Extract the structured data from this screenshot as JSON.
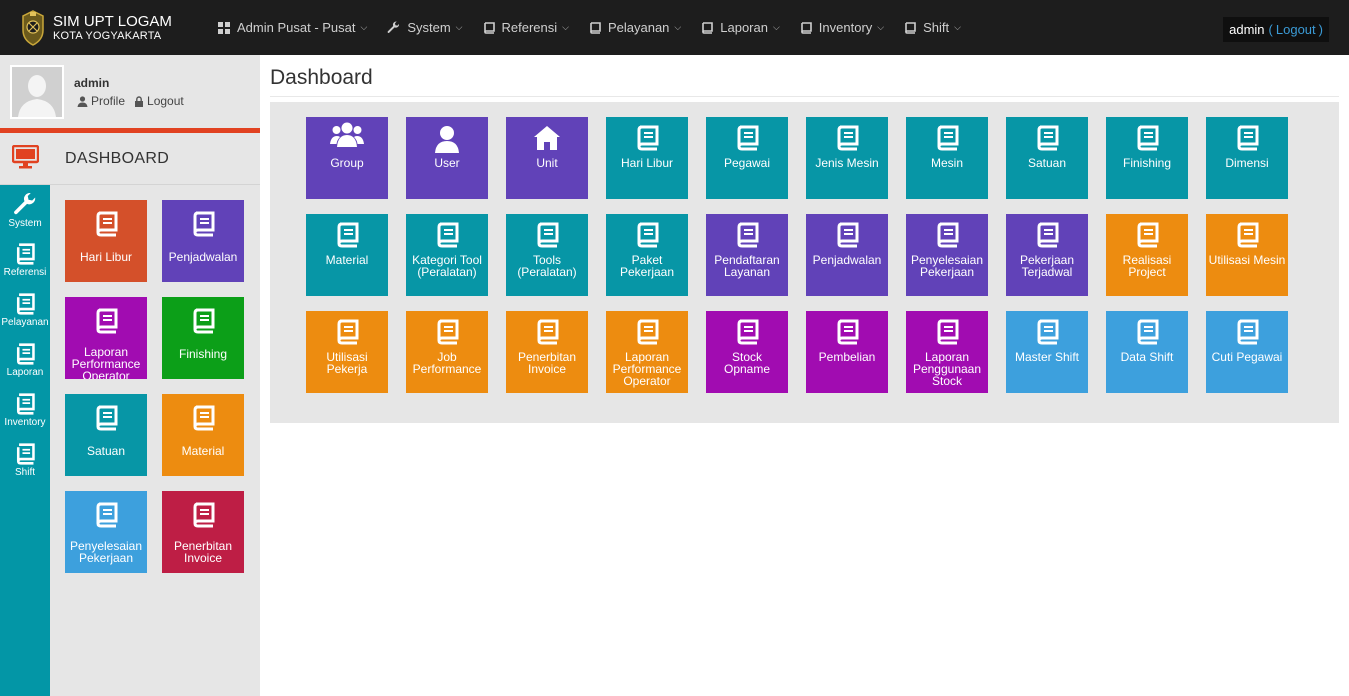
{
  "brand": {
    "title": "SIM UPT LOGAM",
    "subtitle": "KOTA YOGYAKARTA"
  },
  "nav": [
    {
      "label": "Admin Pusat - Pusat",
      "icon": "grid-icon"
    },
    {
      "label": "System",
      "icon": "wrench-icon"
    },
    {
      "label": "Referensi",
      "icon": "book-icon"
    },
    {
      "label": "Pelayanan",
      "icon": "book-icon"
    },
    {
      "label": "Laporan",
      "icon": "book-icon"
    },
    {
      "label": "Inventory",
      "icon": "book-icon"
    },
    {
      "label": "Shift",
      "icon": "book-icon"
    }
  ],
  "user_menu": {
    "name": "admin",
    "open": "(",
    "logout": "Logout",
    "close": ")"
  },
  "sidebar_user": {
    "name": "admin",
    "profile": "Profile",
    "logout": "Logout"
  },
  "sidebar_heading": "DASHBOARD",
  "icon_strip": [
    {
      "label": "System",
      "icon": "wrench-icon"
    },
    {
      "label": "Referensi",
      "icon": "book-icon"
    },
    {
      "label": "Pelayanan",
      "icon": "book-icon"
    },
    {
      "label": "Laporan",
      "icon": "book-icon"
    },
    {
      "label": "Inventory",
      "icon": "book-icon"
    },
    {
      "label": "Shift",
      "icon": "book-icon"
    }
  ],
  "side_tiles": [
    {
      "label": "Hari Libur",
      "color": "#d4502a"
    },
    {
      "label": "Penjadwalan",
      "color": "#6142b8"
    },
    {
      "label": "Laporan Performance Operator",
      "color": "#a10cb1"
    },
    {
      "label": "Finishing",
      "color": "#0c9f18"
    },
    {
      "label": "Satuan",
      "color": "#0796a6"
    },
    {
      "label": "Material",
      "color": "#ed8c10"
    },
    {
      "label": "Penyelesaian Pekerjaan",
      "color": "#3da0dd"
    },
    {
      "label": "Penerbitan Invoice",
      "color": "#be1e45"
    }
  ],
  "page_title": "Dashboard",
  "tiles": [
    {
      "label": "Group",
      "icon": "users-icon",
      "color": "#6142b8"
    },
    {
      "label": "User",
      "icon": "user-icon",
      "color": "#6142b8"
    },
    {
      "label": "Unit",
      "icon": "home-icon",
      "color": "#6142b8"
    },
    {
      "label": "Hari Libur",
      "icon": "book-icon",
      "color": "#0796a6"
    },
    {
      "label": "Pegawai",
      "icon": "book-icon",
      "color": "#0796a6"
    },
    {
      "label": "Jenis Mesin",
      "icon": "book-icon",
      "color": "#0796a6"
    },
    {
      "label": "Mesin",
      "icon": "book-icon",
      "color": "#0796a6"
    },
    {
      "label": "Satuan",
      "icon": "book-icon",
      "color": "#0796a6"
    },
    {
      "label": "Finishing",
      "icon": "book-icon",
      "color": "#0796a6"
    },
    {
      "label": "Dimensi",
      "icon": "book-icon",
      "color": "#0796a6"
    },
    {
      "label": "Material",
      "icon": "book-icon",
      "color": "#0796a6"
    },
    {
      "label": "Kategori Tool (Peralatan)",
      "icon": "book-icon",
      "color": "#0796a6"
    },
    {
      "label": "Tools (Peralatan)",
      "icon": "book-icon",
      "color": "#0796a6"
    },
    {
      "label": "Paket Pekerjaan",
      "icon": "book-icon",
      "color": "#0796a6"
    },
    {
      "label": "Pendaftaran Layanan",
      "icon": "book-icon",
      "color": "#6142b8"
    },
    {
      "label": "Penjadwalan",
      "icon": "book-icon",
      "color": "#6142b8"
    },
    {
      "label": "Penyelesaian Pekerjaan",
      "icon": "book-icon",
      "color": "#6142b8"
    },
    {
      "label": "Pekerjaan Terjadwal",
      "icon": "book-icon",
      "color": "#6142b8"
    },
    {
      "label": "Realisasi Project",
      "icon": "book-icon",
      "color": "#ed8c10"
    },
    {
      "label": "Utilisasi Mesin",
      "icon": "book-icon",
      "color": "#ed8c10"
    },
    {
      "label": "Utilisasi Pekerja",
      "icon": "book-icon",
      "color": "#ed8c10"
    },
    {
      "label": "Job Performance",
      "icon": "book-icon",
      "color": "#ed8c10"
    },
    {
      "label": "Penerbitan Invoice",
      "icon": "book-icon",
      "color": "#ed8c10"
    },
    {
      "label": "Laporan Performance Operator",
      "icon": "book-icon",
      "color": "#ed8c10"
    },
    {
      "label": "Stock Opname",
      "icon": "book-icon",
      "color": "#a10cb1"
    },
    {
      "label": "Pembelian",
      "icon": "book-icon",
      "color": "#a10cb1"
    },
    {
      "label": "Laporan Penggunaan Stock",
      "icon": "book-icon",
      "color": "#a10cb1"
    },
    {
      "label": "Master Shift",
      "icon": "book-icon",
      "color": "#3da0dd"
    },
    {
      "label": "Data Shift",
      "icon": "book-icon",
      "color": "#3da0dd"
    },
    {
      "label": "Cuti Pegawai",
      "icon": "book-icon",
      "color": "#3da0dd"
    }
  ]
}
